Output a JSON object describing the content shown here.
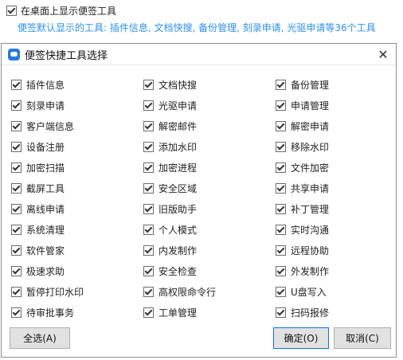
{
  "top_option": {
    "label": "在桌面上显示便签工具",
    "checked": true
  },
  "hint": "便签默认显示的工具: 插件信息, 文档快搜, 备份管理, 刻录申请, 光驱申请等36个工具",
  "dialog": {
    "title": "便签快捷工具选择",
    "close_glyph": "✕",
    "items": [
      "插件信息",
      "文档快搜",
      "备份管理",
      "刻录申请",
      "光驱申请",
      "申请管理",
      "客户端信息",
      "解密邮件",
      "解密申请",
      "设备注册",
      "添加水印",
      "移除水印",
      "加密扫描",
      "加密进程",
      "文件加密",
      "截屏工具",
      "安全区域",
      "共享申请",
      "离线申请",
      "旧版助手",
      "补丁管理",
      "系统清理",
      "个人模式",
      "实时沟通",
      "软件管家",
      "内发制作",
      "远程协助",
      "极速求助",
      "安全检查",
      "外发制作",
      "暂停打印水印",
      "高权限命令行",
      "U盘写入",
      "待审批事务",
      "工单管理",
      "扫码报修"
    ],
    "buttons": {
      "select_all": "全选(A)",
      "ok": "确定(O)",
      "cancel": "取消(C)"
    }
  },
  "colors": {
    "hint": "#2f8ff2",
    "icon": "#2b7ad9"
  },
  "icons": {
    "app": "note-app-icon",
    "close": "close-icon"
  }
}
